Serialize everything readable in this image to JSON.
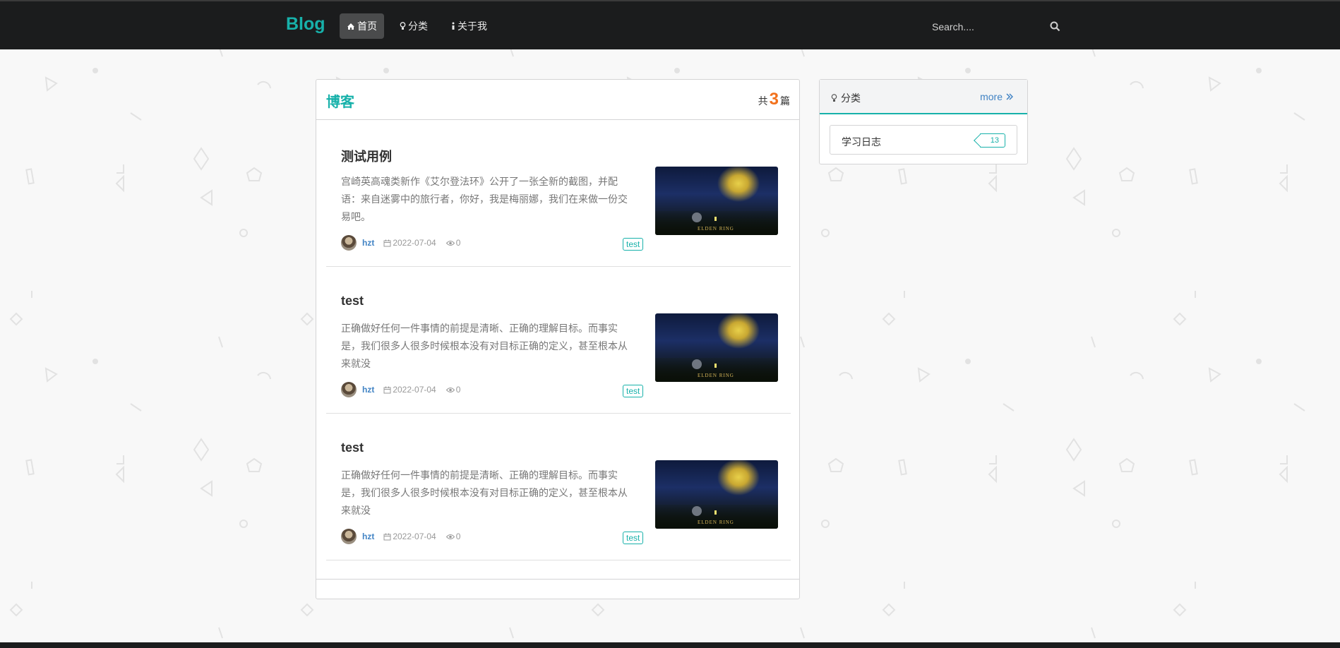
{
  "nav": {
    "brand": "Blog",
    "items": [
      {
        "label": "首页",
        "active": true,
        "icon": "home-icon"
      },
      {
        "label": "分类",
        "active": false,
        "icon": "lightbulb-icon"
      },
      {
        "label": "关于我",
        "active": false,
        "icon": "info-icon"
      }
    ],
    "search_placeholder": "Search....",
    "search_icon": "search-icon"
  },
  "main": {
    "title": "博客",
    "total_prefix": "共",
    "total_count": "3",
    "total_suffix": "篇",
    "posts": [
      {
        "title": "测试用例",
        "description": "宫崎英高魂类新作《艾尔登法环》公开了一张全新的截图，并配语：来自迷雾中的旅行者，你好，我是梅丽娜，我们在来做一份交易吧。",
        "author": "hzt",
        "date": "2022-07-04",
        "views": "0",
        "tag": "test",
        "thumb_caption": "ELDEN RING"
      },
      {
        "title": "test",
        "description": "正确做好任何一件事情的前提是清晰、正确的理解目标。而事实是，我们很多人很多时候根本没有对目标正确的定义，甚至根本从来就没",
        "author": "hzt",
        "date": "2022-07-04",
        "views": "0",
        "tag": "test",
        "thumb_caption": "ELDEN RING"
      },
      {
        "title": "test",
        "description": "正确做好任何一件事情的前提是清晰、正确的理解目标。而事实是，我们很多人很多时候根本没有对目标正确的定义，甚至根本从来就没",
        "author": "hzt",
        "date": "2022-07-04",
        "views": "0",
        "tag": "test",
        "thumb_caption": "ELDEN RING"
      }
    ]
  },
  "sidebar": {
    "title": "分类",
    "more_label": "more",
    "categories": [
      {
        "name": "学习日志",
        "count": "13"
      }
    ]
  },
  "colors": {
    "accent": "#17b1aa",
    "nav_bg": "#1b1c1d",
    "link": "#4183c4",
    "count": "#f2711c"
  }
}
